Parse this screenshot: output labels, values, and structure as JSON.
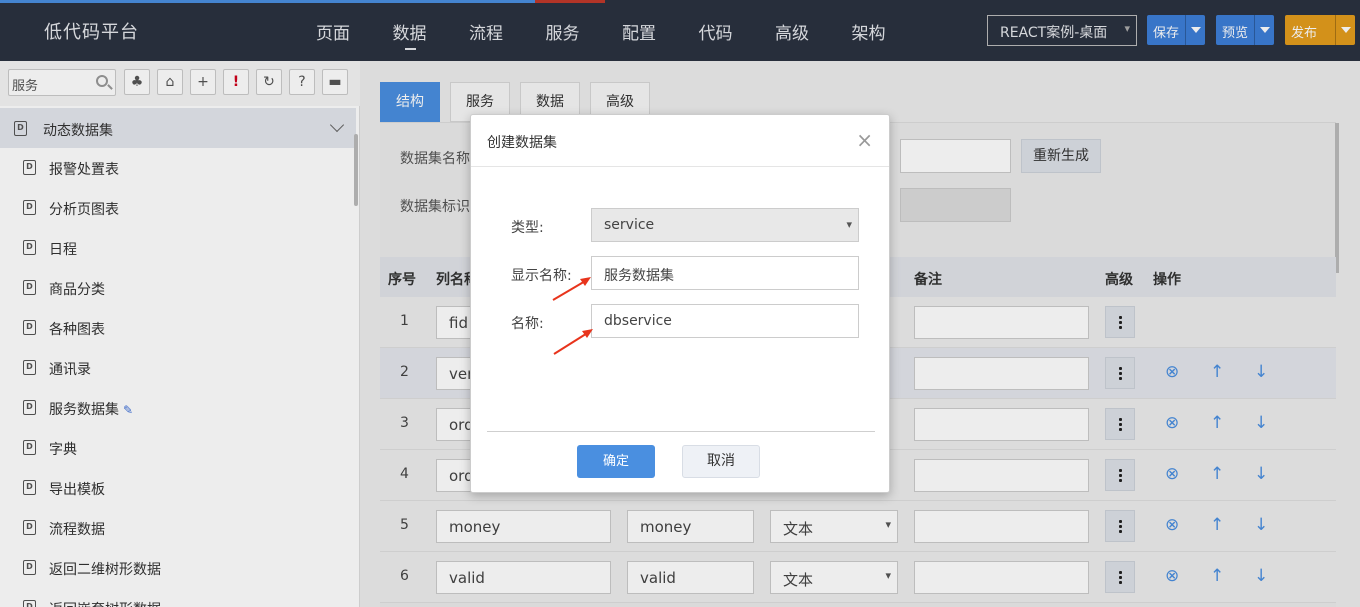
{
  "header": {
    "brand": "低代码平台",
    "nav": [
      "页面",
      "数据",
      "流程",
      "服务",
      "配置",
      "代码",
      "高级",
      "架构"
    ],
    "active_nav": "数据",
    "project": "REACT案例-桌面",
    "save": "保存",
    "preview": "预览",
    "publish": "发布"
  },
  "sidebar": {
    "search_value": "服务",
    "group_label": "动态数据集",
    "items": [
      "报警处置表",
      "分析页图表",
      "日程",
      "商品分类",
      "各种图表",
      "通讯录",
      "服务数据集",
      "字典",
      "导出模板",
      "流程数据",
      "返回二维树形数据",
      "返回嵌套树形数据"
    ]
  },
  "main": {
    "tabs": [
      "结构",
      "服务",
      "数据",
      "高级"
    ],
    "name_label": "数据集名称",
    "id_label": "数据集标识",
    "regen": "重新生成",
    "columns": [
      "序号",
      "列名称",
      "备注",
      "高级",
      "操作"
    ],
    "rows": [
      {
        "idx": "1",
        "name": "fid",
        "title": "",
        "type": ""
      },
      {
        "idx": "2",
        "name": "ver",
        "title": "",
        "type": ""
      },
      {
        "idx": "3",
        "name": "ord",
        "title": "",
        "type": ""
      },
      {
        "idx": "4",
        "name": "ord",
        "title": "",
        "type": ""
      },
      {
        "idx": "5",
        "name": "money",
        "title": "money",
        "type": "文本"
      },
      {
        "idx": "6",
        "name": "valid",
        "title": "valid",
        "type": "文本"
      }
    ]
  },
  "modal": {
    "title": "创建数据集",
    "type_label": "类型:",
    "type_value": "service",
    "display_label": "显示名称:",
    "display_value": "服务数据集",
    "name_label": "名称:",
    "name_value": "dbservice",
    "ok": "确定",
    "cancel": "取消",
    "close": "×"
  },
  "colors": {
    "topbar": "#2b3240",
    "primary": "#4a8fe0",
    "publish": "#e39c1d",
    "annotation_arrow": "#e8341c"
  }
}
